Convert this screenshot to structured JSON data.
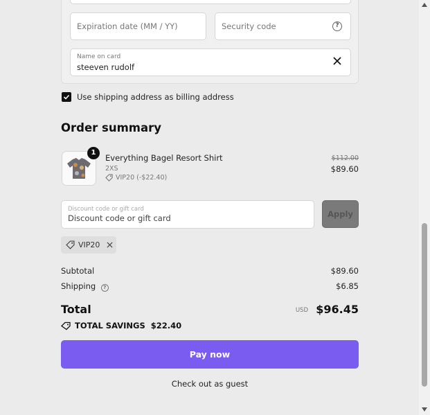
{
  "card_form": {
    "expiration_placeholder": "Expiration date (MM / YY)",
    "security_placeholder": "Security code",
    "help_symbol": "?",
    "name_label": "Name on card",
    "name_value": "steeven rudolf"
  },
  "billing": {
    "checkbox_label": "Use shipping address as billing address",
    "checked": true
  },
  "order_summary": {
    "title": "Order summary",
    "item": {
      "quantity": "1",
      "name": "Everything Bagel Resort Shirt",
      "variant": "2XS",
      "discount": "VIP20 (-$22.40)",
      "price_original": "$112.00",
      "price_final": "$89.60"
    },
    "discount_field": {
      "label": "Discount code or gift card",
      "placeholder": "Discount code or gift card",
      "apply_label": "Apply"
    },
    "applied_code": "VIP20",
    "subtotal_label": "Subtotal",
    "subtotal_value": "$89.60",
    "shipping_label": "Shipping",
    "shipping_value": "$6.85",
    "total_label": "Total",
    "total_currency": "USD",
    "total_value": "$96.45",
    "savings_label": "TOTAL SAVINGS",
    "savings_value": "$22.40"
  },
  "actions": {
    "pay_label": "Pay now",
    "guest_label": "Check out as guest"
  },
  "colors": {
    "accent": "#7b5cf0",
    "background": "#ebebeb"
  }
}
